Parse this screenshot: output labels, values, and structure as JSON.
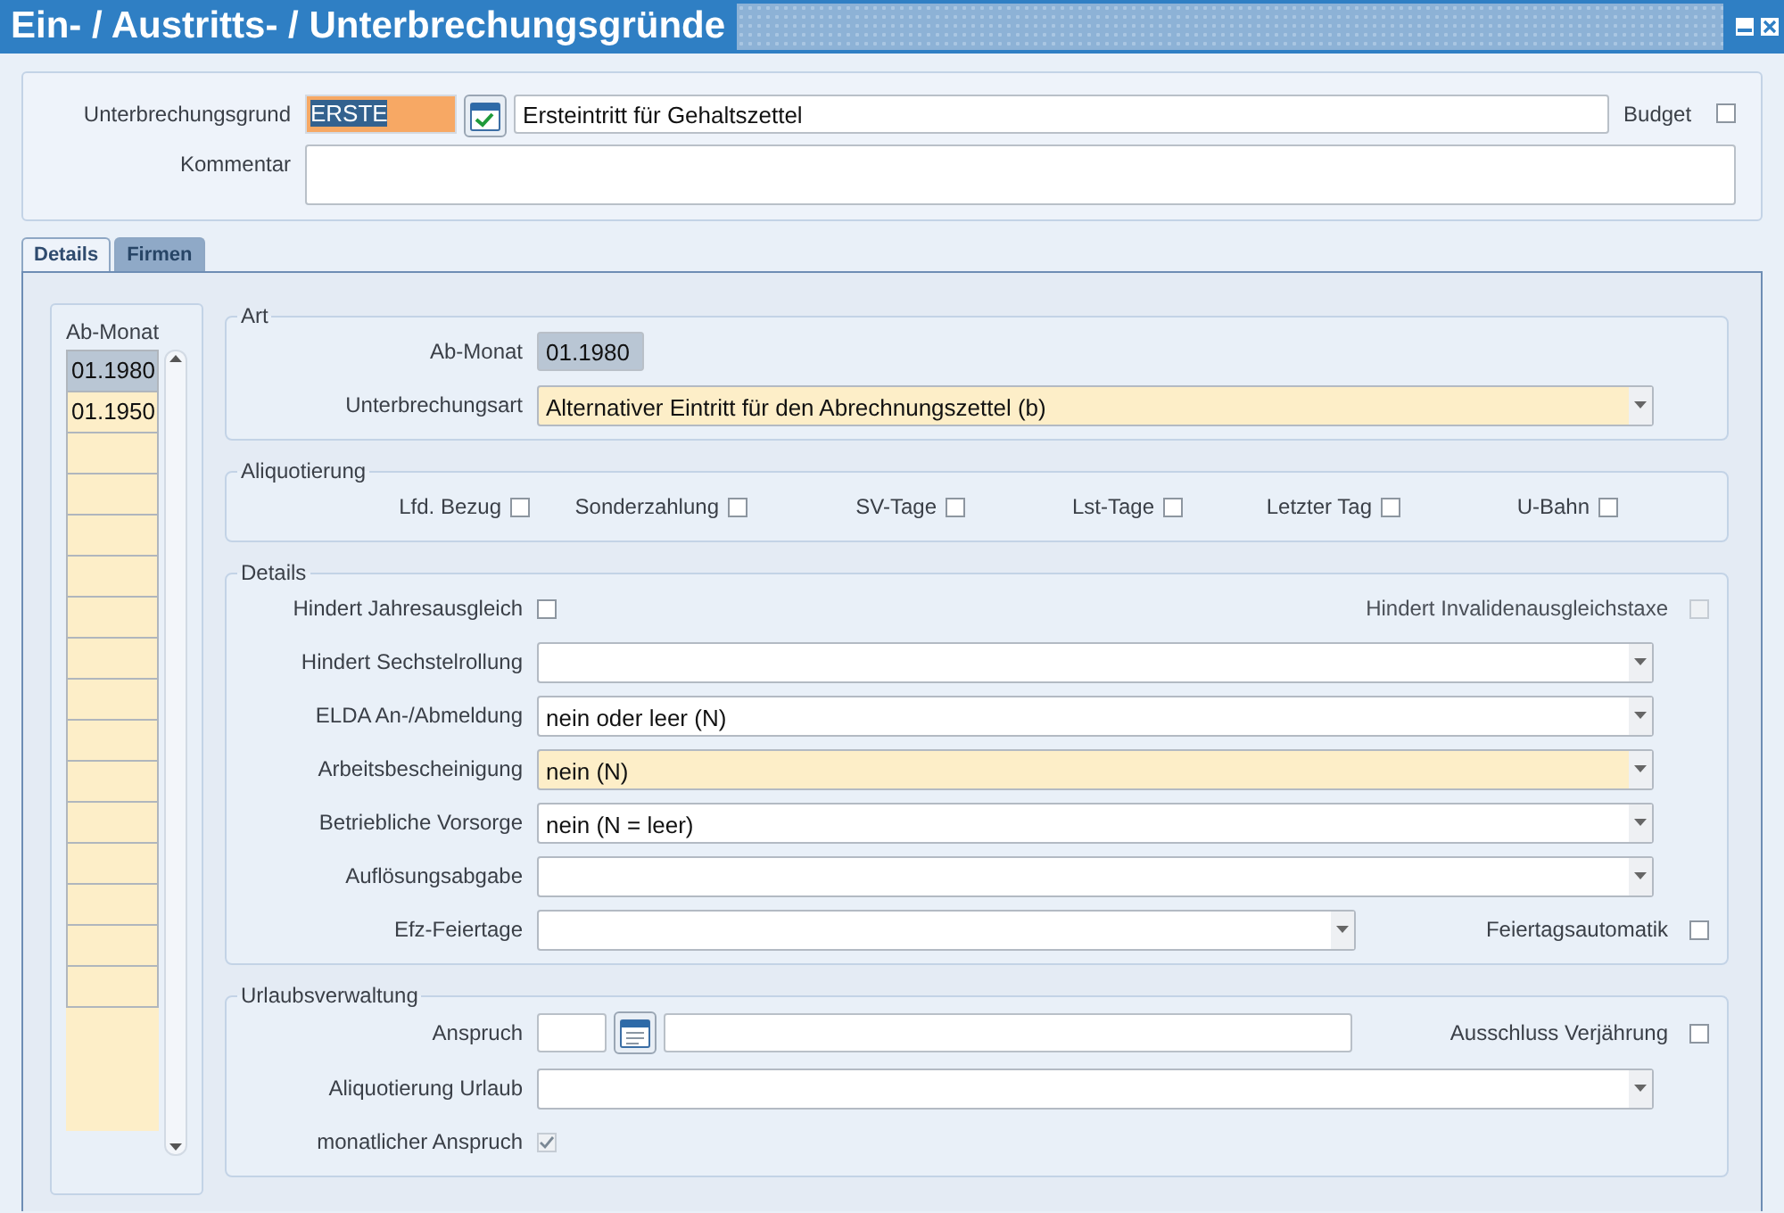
{
  "window": {
    "title": "Ein- / Austritts- / Unterbrechungsgründe"
  },
  "header": {
    "reason_label": "Unterbrechungsgrund",
    "reason_code": "ERSTE",
    "reason_text": "Ersteintritt für Gehaltszettel",
    "budget": {
      "label": "Budget",
      "checked": false
    },
    "comment_label": "Kommentar"
  },
  "tabs": [
    {
      "label": "Details",
      "selected": true
    },
    {
      "label": "Firmen",
      "selected": false
    }
  ],
  "month_list": {
    "heading": "Ab-Monat",
    "rows": [
      {
        "value": "01.1980",
        "selected": true
      },
      {
        "value": "01.1950",
        "selected": false
      }
    ]
  },
  "groups": [
    {
      "title": "Art",
      "rows": [
        {
          "kind": "readonly",
          "label": "Ab-Monat",
          "value": "01.1980"
        },
        {
          "kind": "select",
          "label": "Unterbrechungsart",
          "value": "Alternativer Eintritt für den Abrechnungszettel (b)",
          "required": true
        }
      ]
    },
    {
      "title": "Aliquotierung",
      "rows": [
        {
          "kind": "checkboxes",
          "items": [
            {
              "label": "Lfd. Bezug",
              "checked": false
            },
            {
              "label": "Sonderzahlung",
              "checked": false
            },
            {
              "label": "SV-Tage",
              "checked": false
            },
            {
              "label": "Lst-Tage",
              "checked": false
            },
            {
              "label": "Letzter Tag",
              "checked": false
            },
            {
              "label": "U-Bahn",
              "checked": false
            }
          ]
        }
      ]
    },
    {
      "title": "Details",
      "rows": [
        {
          "kind": "check_pair",
          "left": {
            "label": "Hindert Jahresausgleich",
            "checked": false,
            "disabled": false
          },
          "right": {
            "label": "Hindert Invalidenausgleichstaxe",
            "checked": false,
            "disabled": true
          }
        },
        {
          "kind": "select",
          "label": "Hindert Sechstelrollung",
          "value": "",
          "required": false
        },
        {
          "kind": "select",
          "label": "ELDA An-/Abmeldung",
          "value": "nein oder leer (N)",
          "required": false
        },
        {
          "kind": "select",
          "label": "Arbeitsbescheinigung",
          "value": "nein (N)",
          "required": true
        },
        {
          "kind": "select",
          "label": "Betriebliche Vorsorge",
          "value": "nein (N = leer)",
          "required": false
        },
        {
          "kind": "select",
          "label": "Auflösungsabgabe",
          "value": "",
          "required": false
        },
        {
          "kind": "select_check",
          "label": "Efz-Feiertage",
          "value": "",
          "check": {
            "label": "Feiertagsautomatik",
            "checked": false
          }
        }
      ]
    },
    {
      "title": "Urlaubsverwaltung",
      "rows": [
        {
          "kind": "date_check",
          "label": "Anspruch",
          "check": {
            "label": "Ausschluss Verjährung",
            "checked": false
          }
        },
        {
          "kind": "select",
          "label": "Aliquotierung Urlaub",
          "value": "",
          "required": false
        },
        {
          "kind": "check",
          "label": "monatlicher Anspruch",
          "checked": true,
          "disabled": true
        }
      ]
    }
  ]
}
